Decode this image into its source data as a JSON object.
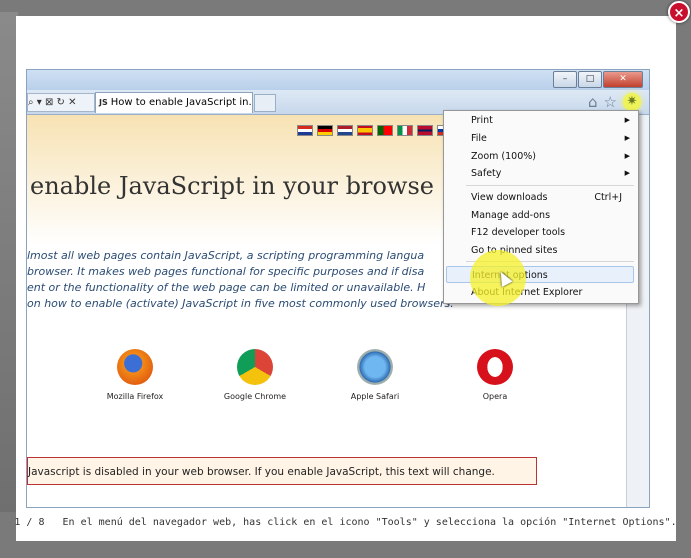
{
  "lightbox": {
    "close_symbol": "×",
    "caption_counter": "1 / 8",
    "caption_text": "En el menú del navegador web, has click en el icono \"Tools\" y selecciona la opción \"Internet Options\"."
  },
  "browser": {
    "window_buttons": {
      "minimize": "–",
      "maximize": "□",
      "close": "✕"
    },
    "tab_icon": "JS",
    "tab_title": "How to enable JavaScript in...",
    "toolbar_icons": [
      "home-icon",
      "star-icon",
      "gear-icon"
    ]
  },
  "page": {
    "headline": "enable JavaScript in your browse",
    "intro_lines": [
      "lmost all web pages contain JavaScript, a scripting programming langua",
      "browser. It makes web pages functional for specific purposes and if disa",
      "ent or the functionality of the web page can be limited or unavailable. H",
      "on how to enable (activate) JavaScript in five most commonly used browsers."
    ],
    "browsers": [
      "Mozilla Firefox",
      "Google Chrome",
      "Apple Safari",
      "Opera"
    ],
    "note": "Javascript is disabled in your web browser. If you enable JavaScript, this text will change."
  },
  "menu": {
    "items": [
      {
        "label": "Print",
        "shortcut": "",
        "submenu": true
      },
      {
        "label": "File",
        "shortcut": "",
        "submenu": true
      },
      {
        "label": "Zoom (100%)",
        "shortcut": "",
        "submenu": true
      },
      {
        "label": "Safety",
        "shortcut": "",
        "submenu": true
      },
      {
        "label": "View downloads",
        "shortcut": "Ctrl+J",
        "submenu": false
      },
      {
        "label": "Manage add-ons",
        "shortcut": "",
        "submenu": false
      },
      {
        "label": "F12 developer tools",
        "shortcut": "",
        "submenu": false
      },
      {
        "label": "Go to pinned sites",
        "shortcut": "",
        "submenu": false
      },
      {
        "label": "Internet options",
        "shortcut": "",
        "submenu": false,
        "highlighted": true
      },
      {
        "label": "About Internet Explorer",
        "shortcut": "",
        "submenu": false
      }
    ]
  },
  "colors": {
    "accent_highlight": "#f5f028",
    "close_button": "#c8102e"
  }
}
